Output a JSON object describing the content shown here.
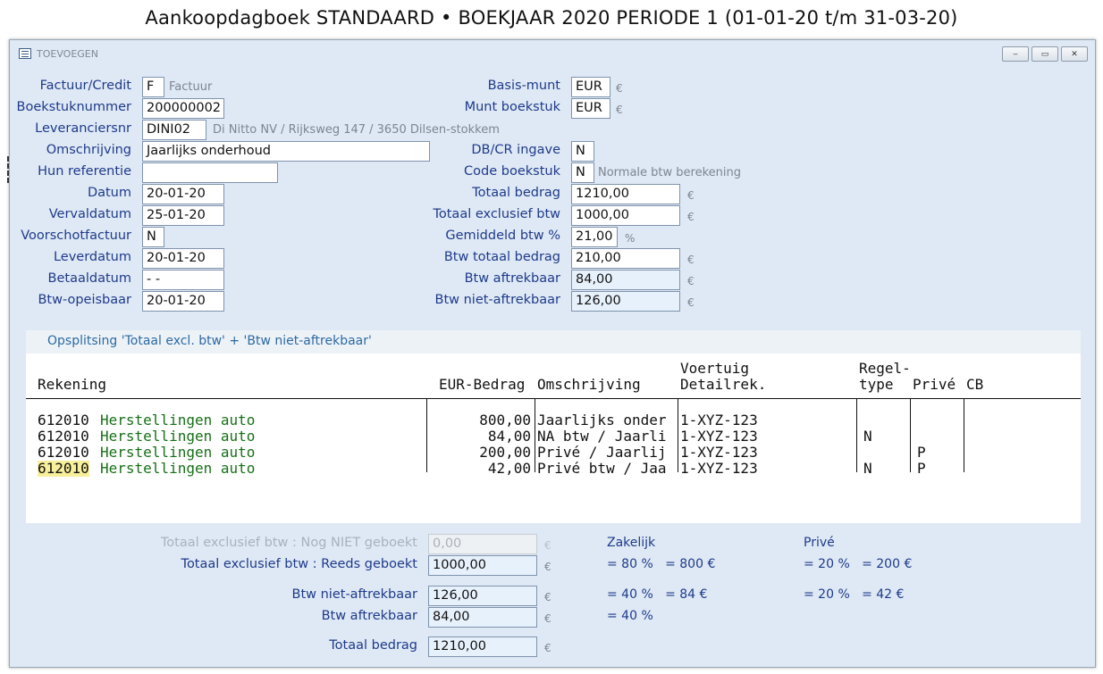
{
  "page_title": "Aankoopdagboek STANDAARD • BOEKJAAR 2020 PERIODE 1 (01-01-20 t/m 31-03-20)",
  "window": {
    "title": "TOEVOEGEN",
    "buttons": [
      "‒",
      "▭",
      "✕"
    ]
  },
  "left_fields": [
    {
      "label": "Factuur/Credit",
      "value": "F",
      "hint": "Factuur"
    },
    {
      "label": "Boekstuknummer",
      "value": "200000002",
      "hint": ""
    },
    {
      "label": "Leveranciersnr",
      "value": "DINI02",
      "hint": "Di Nitto NV / Rijksweg 147 / 3650 Dilsen-stokkem"
    },
    {
      "label": "Omschrijving",
      "value": "Jaarlijks onderhoud",
      "hint": ""
    },
    {
      "label": "Hun referentie",
      "value": "",
      "hint": ""
    },
    {
      "label": "Datum",
      "value": "20-01-20",
      "hint": ""
    },
    {
      "label": "Vervaldatum",
      "value": "25-01-20",
      "hint": ""
    },
    {
      "label": "Voorschotfactuur",
      "value": "N",
      "hint": ""
    },
    {
      "label": "Leverdatum",
      "value": "20-01-20",
      "hint": ""
    },
    {
      "label": "Betaaldatum",
      "value": "- -",
      "hint": ""
    },
    {
      "label": "Btw-opeisbaar",
      "value": "20-01-20",
      "hint": ""
    }
  ],
  "right_fields": [
    {
      "label": "Basis-munt",
      "value": "EUR",
      "unit": "€",
      "hint": ""
    },
    {
      "label": "Munt boekstuk",
      "value": "EUR",
      "unit": "€",
      "hint": ""
    },
    {
      "label": "DB/CR ingave",
      "value": "N",
      "unit": "",
      "hint": ""
    },
    {
      "label": "Code boekstuk",
      "value": "N",
      "unit": "",
      "hint": "Normale btw berekening"
    },
    {
      "label": "Totaal bedrag",
      "value": "1210,00",
      "unit": "€",
      "hint": ""
    },
    {
      "label": "Totaal exclusief btw",
      "value": "1000,00",
      "unit": "€",
      "hint": ""
    },
    {
      "label": "Gemiddeld btw %",
      "value": "21,00",
      "unit": "%",
      "hint": ""
    },
    {
      "label": "Btw totaal bedrag",
      "value": "210,00",
      "unit": "€",
      "hint": ""
    },
    {
      "label": "Btw aftrekbaar",
      "value": "84,00",
      "unit": "€",
      "hint": ""
    },
    {
      "label": "Btw niet-aftrekbaar",
      "value": "126,00",
      "unit": "€",
      "hint": ""
    }
  ],
  "split": {
    "title": "Opsplitsing 'Totaal excl. btw' + 'Btw niet-aftrekbaar'",
    "headers": {
      "rekening": "Rekening",
      "bedrag": "EUR-Bedrag",
      "omschrijving": "Omschrijving",
      "voertuig": "Voertuig",
      "detailrek": "Detailrek.",
      "regel1": "Regel-",
      "regel2": "type",
      "prive": "Privé",
      "cb": "CB"
    },
    "rows": [
      {
        "account": "612010",
        "name": "Herstellingen auto",
        "amount": "800,00",
        "desc": "Jaarlijks onder",
        "vehicle": "1-XYZ-123",
        "type": "",
        "prive": ""
      },
      {
        "account": "612010",
        "name": "Herstellingen auto",
        "amount": "84,00",
        "desc": "NA btw / Jaarli",
        "vehicle": "1-XYZ-123",
        "type": "N",
        "prive": ""
      },
      {
        "account": "612010",
        "name": "Herstellingen auto",
        "amount": "200,00",
        "desc": "Privé / Jaarlij",
        "vehicle": "1-XYZ-123",
        "type": "",
        "prive": "P"
      },
      {
        "account": "612010",
        "name": "Herstellingen auto",
        "amount": "42,00",
        "desc": "Privé btw / Jaa",
        "vehicle": "1-XYZ-123",
        "type": "N",
        "prive": "P"
      }
    ]
  },
  "summary": {
    "not_booked_label": "Totaal exclusief btw : Nog NIET geboekt",
    "not_booked_value": "0,00",
    "booked_label": "Totaal exclusief btw : Reeds geboekt",
    "booked_value": "1000,00",
    "na_label": "Btw niet-aftrekbaar",
    "na_value": "126,00",
    "aftrek_label": "Btw aftrekbaar",
    "aftrek_value": "84,00",
    "total_label": "Totaal bedrag",
    "total_value": "1210,00",
    "currency": "€",
    "zakelijk_head": "Zakelijk",
    "prive_head": "Privé",
    "zak_booked": "= 80 %   = 800 €",
    "zak_na": "= 40 %   = 84 €",
    "zak_aftrek": "= 40 %",
    "priv_booked": "= 20 %   = 200 €",
    "priv_na": "= 20 %   = 42 €"
  }
}
